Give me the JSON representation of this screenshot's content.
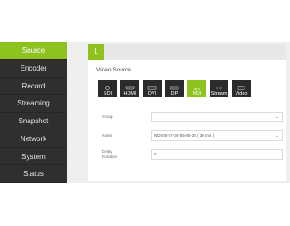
{
  "sidebar": {
    "items": [
      {
        "label": "Source",
        "active": true
      },
      {
        "label": "Encoder",
        "active": false
      },
      {
        "label": "Record",
        "active": false
      },
      {
        "label": "Streaming",
        "active": false
      },
      {
        "label": "Snapshot",
        "active": false
      },
      {
        "label": "Network",
        "active": false
      },
      {
        "label": "System",
        "active": false
      },
      {
        "label": "Status",
        "active": false
      }
    ]
  },
  "panel": {
    "tab_number": "1",
    "section_title": "Video Source",
    "sources": [
      {
        "label": "SDI",
        "icon": "sdi-connector-icon",
        "active": false
      },
      {
        "label": "HDMI",
        "icon": "hdmi-connector-icon",
        "active": false
      },
      {
        "label": "DVI",
        "icon": "dvi-connector-icon",
        "active": false
      },
      {
        "label": "DP",
        "icon": "displayport-connector-icon",
        "active": false
      },
      {
        "top": "NDI",
        "label": "NDI",
        "icon": "ndi-icon",
        "active": true
      },
      {
        "label": "Stream",
        "icon": "stream-icon",
        "active": false
      },
      {
        "label": "Video",
        "icon": "video-file-icon",
        "active": false
      }
    ],
    "group": {
      "label": "Group",
      "value": ""
    },
    "name": {
      "label": "Name",
      "value": "NDI-00-07-36-05-80-25 ( 30 min )"
    },
    "delay": {
      "label_line1": "Delay",
      "label_line2": "Duration",
      "value": "0"
    }
  },
  "colors": {
    "accent": "#8dc21f",
    "sidebar_bg": "#2f2f2f",
    "button_bg": "#2b2b2b"
  }
}
